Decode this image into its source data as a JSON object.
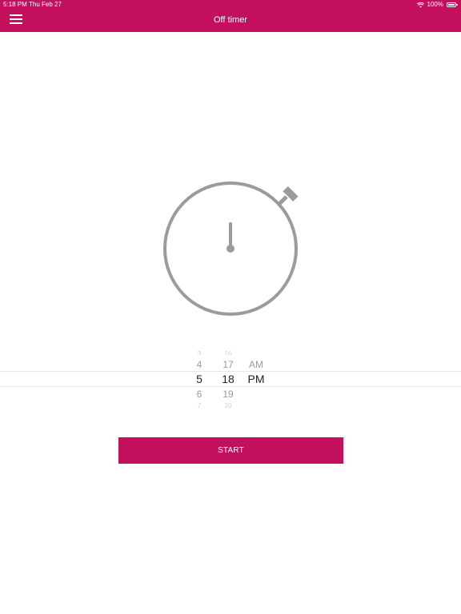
{
  "status_bar": {
    "time": "5:18 PM",
    "date": "Thu Feb 27",
    "battery": "100%"
  },
  "header": {
    "title": "Off timer",
    "menu_icon": "hamburger-menu-icon"
  },
  "timer_icon": "stopwatch-icon",
  "picker": {
    "hours": [
      "3",
      "4",
      "5",
      "6",
      "7"
    ],
    "minutes": [
      "16",
      "17",
      "18",
      "19",
      "20"
    ],
    "periods": [
      "AM",
      "PM"
    ],
    "selected_hour": "5",
    "selected_minute": "18",
    "selected_period": "PM"
  },
  "start_button": {
    "label": "START"
  },
  "colors": {
    "accent": "#c2105d",
    "icon_gray": "#9b9b9b",
    "text_dark": "#222222",
    "text_muted": "#9a9a9a"
  }
}
